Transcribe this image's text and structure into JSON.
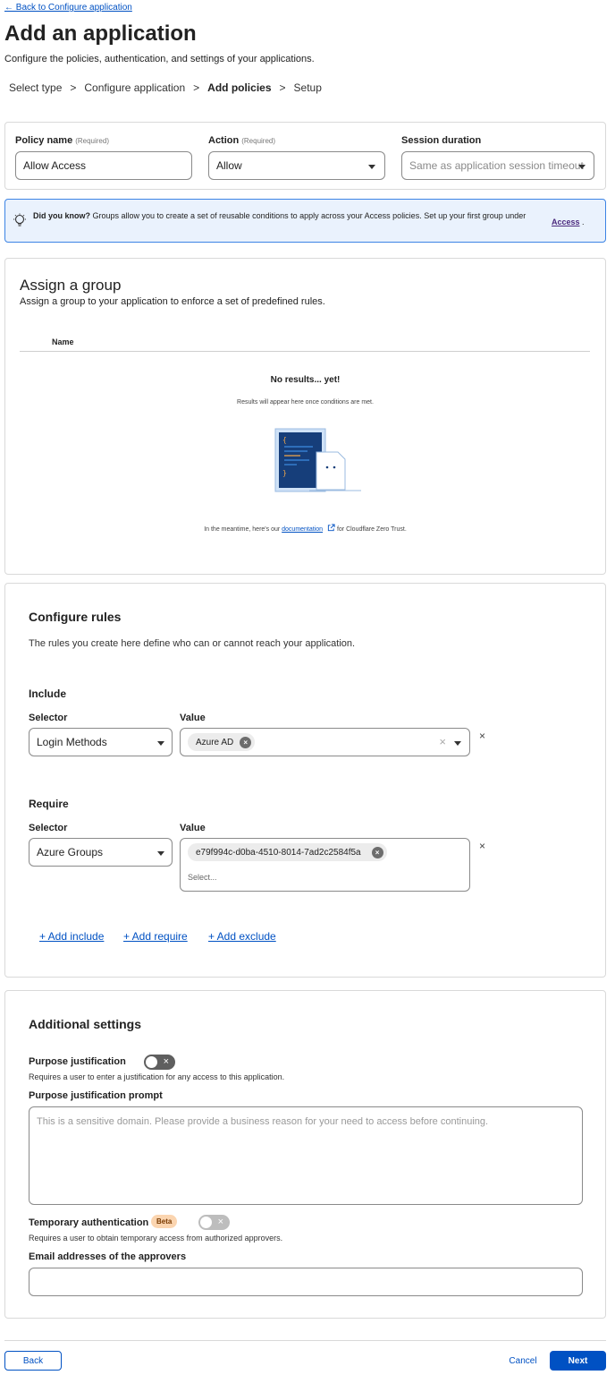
{
  "nav": {
    "back_link": "← Back to Configure application"
  },
  "header": {
    "title": "Add an application",
    "subtitle": "Configure the policies, authentication, and settings of your applications."
  },
  "steps": [
    {
      "label": "Select type"
    },
    {
      "label": "Configure application"
    },
    {
      "label": "Add policies"
    },
    {
      "label": "Setup"
    }
  ],
  "step_separator": ">",
  "policy": {
    "name_label": "Policy name",
    "name_required": "(Required)",
    "name_value": "Allow Access",
    "action_label": "Action",
    "action_required": "(Required)",
    "action_value": "Allow",
    "session_label": "Session duration",
    "session_placeholder": "Same as application session timeout"
  },
  "tip": {
    "bold": "Did you know?",
    "text": " Groups allow you to create a set of reusable conditions to apply across your Access policies. Set up your first group under",
    "link": "Access",
    "end": "."
  },
  "group": {
    "title": "Assign a group",
    "subtitle": "Assign a group to your application to enforce a set of predefined rules.",
    "col_name": "Name",
    "empty_title": "No results... yet!",
    "empty_text": "Results will appear here once conditions are met.",
    "doc_prefix": "In the meantime, here's our ",
    "doc_link": "documentation",
    "doc_suffix": " for Cloudflare Zero Trust."
  },
  "rules": {
    "title": "Configure rules",
    "description": "The rules you create here define who can or cannot reach your application.",
    "include": {
      "title": "Include",
      "selector_label": "Selector",
      "value_label": "Value",
      "selector_value": "Login Methods",
      "chips": [
        "Azure AD"
      ]
    },
    "require": {
      "title": "Require",
      "selector_label": "Selector",
      "value_label": "Value",
      "selector_value": "Azure Groups",
      "chips": [
        "e79f994c-d0ba-4510-8014-7ad2c2584f5a"
      ],
      "select_placeholder": "Select..."
    },
    "add_include": "+ Add include",
    "add_require": "+ Add require",
    "add_exclude": "+ Add exclude",
    "remove_glyph": "×"
  },
  "additional": {
    "title": "Additional settings",
    "purpose_label": "Purpose justification",
    "purpose_desc": "Requires a user to enter a justification for any access to this application.",
    "purpose_prompt_label": "Purpose justification prompt",
    "purpose_prompt_placeholder": "This is a sensitive domain. Please provide a business reason for your need to access before continuing.",
    "temp_label": "Temporary authentication",
    "temp_badge": "Beta",
    "temp_desc": "Requires a user to obtain temporary access from authorized approvers.",
    "approvers_label": "Email addresses of the approvers"
  },
  "footer": {
    "back": "Back",
    "cancel": "Cancel",
    "next": "Next"
  },
  "colors": {
    "accent": "#0051c3",
    "info_bg": "#eaf2fd",
    "badge_bg": "#fbd5b0"
  }
}
